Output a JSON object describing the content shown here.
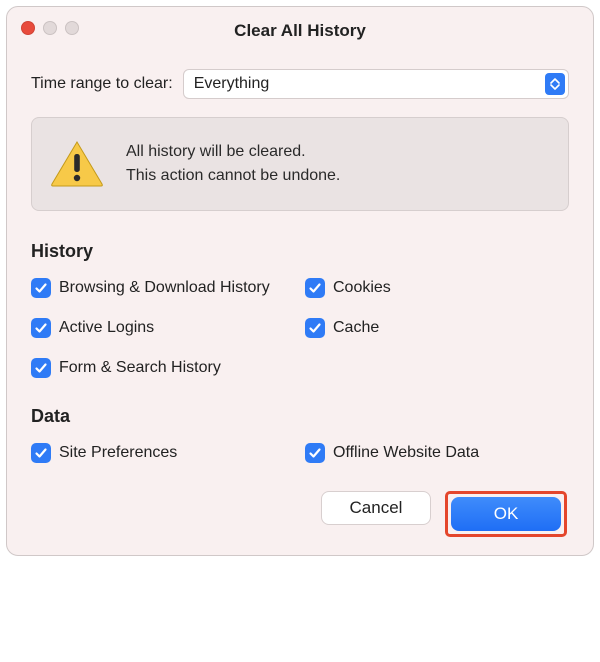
{
  "window": {
    "title": "Clear All History"
  },
  "range": {
    "label": "Time range to clear:",
    "value": "Everything"
  },
  "alert": {
    "line1": "All history will be cleared.",
    "line2": "This action cannot be undone."
  },
  "sections": {
    "history": {
      "title": "History",
      "items": {
        "browsing": "Browsing & Download History",
        "cookies": "Cookies",
        "logins": "Active Logins",
        "cache": "Cache",
        "form": "Form & Search History"
      }
    },
    "data": {
      "title": "Data",
      "items": {
        "siteprefs": "Site Preferences",
        "offline": "Offline Website Data"
      }
    }
  },
  "buttons": {
    "cancel": "Cancel",
    "ok": "OK"
  }
}
